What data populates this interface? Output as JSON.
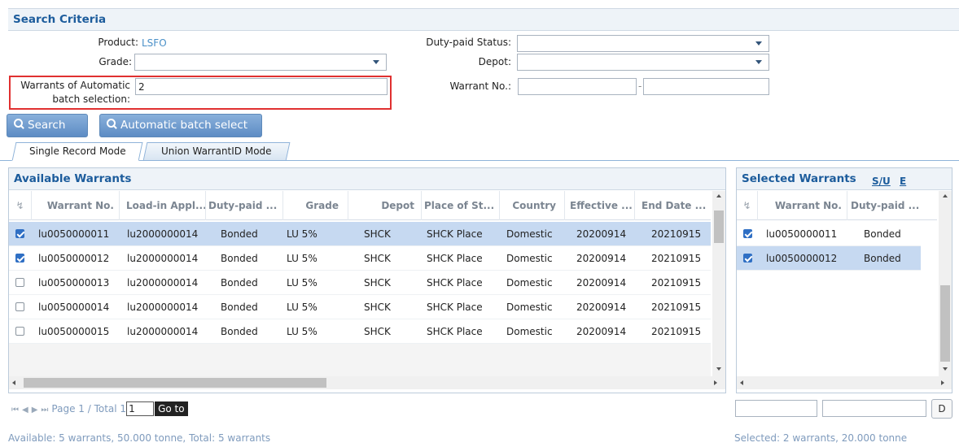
{
  "criteria": {
    "title": "Search Criteria",
    "product_label": "Product:",
    "product_value": "LSFO",
    "grade_label": "Grade:",
    "grade_value": "",
    "warrants_auto_label": "Warrants of Automatic",
    "warrants_auto_label2": "batch selection:",
    "warrants_auto_value": "2",
    "duty_status_label": "Duty-paid Status:",
    "duty_status_value": "",
    "depot_label": "Depot:",
    "depot_value": "",
    "warrant_no_label": "Warrant No.:",
    "warrant_no_from": "",
    "warrant_no_sep": "-",
    "warrant_no_to": ""
  },
  "buttons": {
    "search": "Search",
    "auto_batch": "Automatic batch select"
  },
  "tabs": [
    {
      "label": "Single Record Mode",
      "active": true
    },
    {
      "label": "Union WarrantID Mode",
      "active": false
    }
  ],
  "available": {
    "title": "Available Warrants",
    "columns": [
      "Warrant No.",
      "Load-in Appl...",
      "Duty-paid ...",
      "Grade",
      "Depot",
      "Place of St...",
      "Country",
      "Effective ...",
      "End Date ..."
    ],
    "rows": [
      {
        "checked": true,
        "selected": true,
        "cells": [
          "lu0050000011",
          "lu2000000014",
          "Bonded",
          "LU 5%",
          "SHCK",
          "SHCK Place",
          "Domestic",
          "20200914",
          "20210915"
        ]
      },
      {
        "checked": true,
        "selected": false,
        "cells": [
          "lu0050000012",
          "lu2000000014",
          "Bonded",
          "LU 5%",
          "SHCK",
          "SHCK Place",
          "Domestic",
          "20200914",
          "20210915"
        ]
      },
      {
        "checked": false,
        "selected": false,
        "cells": [
          "lu0050000013",
          "lu2000000014",
          "Bonded",
          "LU 5%",
          "SHCK",
          "SHCK Place",
          "Domestic",
          "20200914",
          "20210915"
        ]
      },
      {
        "checked": false,
        "selected": false,
        "cells": [
          "lu0050000014",
          "lu2000000014",
          "Bonded",
          "LU 5%",
          "SHCK",
          "SHCK Place",
          "Domestic",
          "20200914",
          "20210915"
        ]
      },
      {
        "checked": false,
        "selected": false,
        "cells": [
          "lu0050000015",
          "lu2000000014",
          "Bonded",
          "LU 5%",
          "SHCK",
          "SHCK Place",
          "Domestic",
          "20200914",
          "20210915"
        ]
      }
    ]
  },
  "selected": {
    "title": "Selected Warrants",
    "link_su": "S/U",
    "link_e": "E",
    "columns": [
      "Warrant No.",
      "Duty-paid ..."
    ],
    "rows": [
      {
        "checked": true,
        "selected": false,
        "cells": [
          "lu0050000011",
          "Bonded"
        ]
      },
      {
        "checked": true,
        "selected": true,
        "cells": [
          "lu0050000012",
          "Bonded"
        ]
      }
    ],
    "filter_a": "",
    "filter_b": "",
    "filter_button": "D"
  },
  "pager": {
    "page_text": "Page 1 / Total 1",
    "page_value": "1",
    "goto": "Go to"
  },
  "status": {
    "available": "Available: 5 warrants, 50.000 tonne, Total: 5 warrants",
    "selected": "Selected: 2 warrants, 20.000 tonne"
  }
}
